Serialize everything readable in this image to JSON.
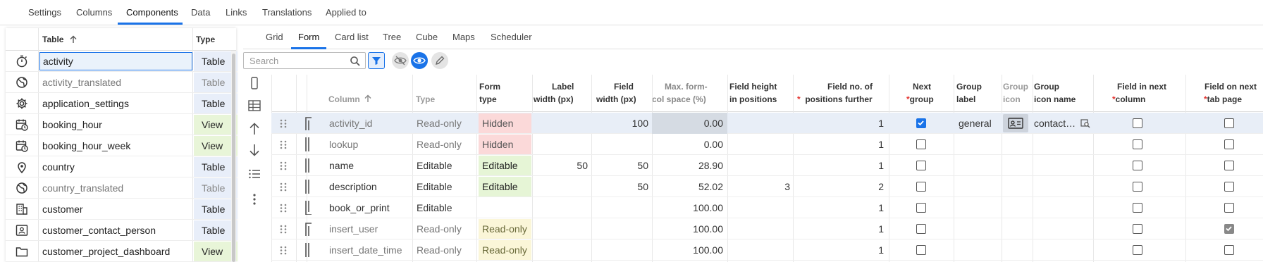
{
  "top_tabs": [
    "Settings",
    "Columns",
    "Components",
    "Data",
    "Links",
    "Translations",
    "Applied to"
  ],
  "top_active": "Components",
  "left_panel": {
    "col_table": "Table",
    "col_type": "Type",
    "rows": [
      {
        "name": "activity",
        "type": "Table",
        "icon": "stopwatch-icon",
        "selected": true
      },
      {
        "name": "activity_translated",
        "type": "Table",
        "icon": "globe-icon",
        "dim": true
      },
      {
        "name": "application_settings",
        "type": "Table",
        "icon": "gear-icon"
      },
      {
        "name": "booking_hour",
        "type": "View",
        "icon": "calendar-clock-icon"
      },
      {
        "name": "booking_hour_week",
        "type": "View",
        "icon": "calendar-clock-icon"
      },
      {
        "name": "country",
        "type": "Table",
        "icon": "map-pin-icon"
      },
      {
        "name": "country_translated",
        "type": "Table",
        "icon": "globe-icon",
        "dim": true
      },
      {
        "name": "customer",
        "type": "Table",
        "icon": "building-icon"
      },
      {
        "name": "customer_contact_person",
        "type": "Table",
        "icon": "contact-card-icon"
      },
      {
        "name": "customer_project_dashboard",
        "type": "View",
        "icon": "folder-icon"
      }
    ]
  },
  "sub_tabs": [
    "Grid",
    "Form",
    "Card list",
    "Tree",
    "Cube",
    "Maps",
    "Scheduler"
  ],
  "sub_active": "Form",
  "search": {
    "placeholder": "Search"
  },
  "grid": {
    "headers": {
      "column": "Column",
      "type": "Type",
      "form_type_1": "Form",
      "form_type_2": "type",
      "label_width_1": "Label",
      "label_width_2": "width (px)",
      "field_width_1": "Field",
      "field_width_2": "width (px)",
      "max_form_1": "Max. form-",
      "max_form_2": "col space (%)",
      "field_height_1": "Field height",
      "field_height_2": "in positions",
      "field_no_1": "Field no. of",
      "field_no_2": "positions further",
      "next_group_1": "Next",
      "next_group_2": "group",
      "group_label_1": "Group",
      "group_label_2": "label",
      "group_icon_1": "Group",
      "group_icon_2": "icon",
      "group_icon_name_1": "Group",
      "group_icon_name_2": "icon name",
      "next_column_1": "Field in next",
      "next_column_2": "column",
      "next_tab_1": "Field on next",
      "next_tab_2": "tab page",
      "required_mark": "*"
    },
    "rows": [
      {
        "column": "activity_id",
        "type": "Read-only",
        "form_type": "Hidden",
        "form_kind": "hidden",
        "label_w": "",
        "field_w": "100",
        "max_space": "0.00",
        "height": "",
        "further": "1",
        "next_group": true,
        "group_label": "general",
        "has_icon": true,
        "icon_name": "contact…",
        "next_col": false,
        "next_tab": false,
        "bracket": "top",
        "dim": true
      },
      {
        "column": "lookup",
        "type": "Read-only",
        "form_type": "Hidden",
        "form_kind": "hidden",
        "label_w": "",
        "field_w": "",
        "max_space": "0.00",
        "height": "",
        "further": "1",
        "next_group": false,
        "next_col": false,
        "next_tab": false,
        "bracket": "mid",
        "dim": true
      },
      {
        "column": "name",
        "type": "Editable",
        "form_type": "Editable",
        "form_kind": "editable",
        "label_w": "50",
        "field_w": "50",
        "max_space": "28.90",
        "height": "",
        "further": "1",
        "next_group": false,
        "next_col": false,
        "next_tab": false,
        "bracket": "mid"
      },
      {
        "column": "description",
        "type": "Editable",
        "form_type": "Editable",
        "form_kind": "editable",
        "label_w": "",
        "field_w": "50",
        "max_space": "52.02",
        "height": "3",
        "further": "2",
        "next_group": false,
        "next_col": false,
        "next_tab": false,
        "bracket": "mid"
      },
      {
        "column": "book_or_print",
        "type": "Editable",
        "form_type": "",
        "form_kind": "",
        "label_w": "",
        "field_w": "",
        "max_space": "100.00",
        "height": "",
        "further": "1",
        "next_group": false,
        "next_col": false,
        "next_tab": false,
        "bracket": "bottom"
      },
      {
        "column": "insert_user",
        "type": "Read-only",
        "form_type": "Read-only",
        "form_kind": "readonly",
        "label_w": "",
        "field_w": "",
        "max_space": "100.00",
        "height": "",
        "further": "1",
        "next_group": false,
        "next_col": false,
        "next_tab": true,
        "bracket": "top",
        "dim": true
      },
      {
        "column": "insert_date_time",
        "type": "Read-only",
        "form_type": "Read-only",
        "form_kind": "readonly",
        "label_w": "",
        "field_w": "",
        "max_space": "100.00",
        "height": "",
        "further": "1",
        "next_group": false,
        "next_col": false,
        "next_tab": false,
        "bracket": "mid",
        "dim": true
      }
    ]
  }
}
